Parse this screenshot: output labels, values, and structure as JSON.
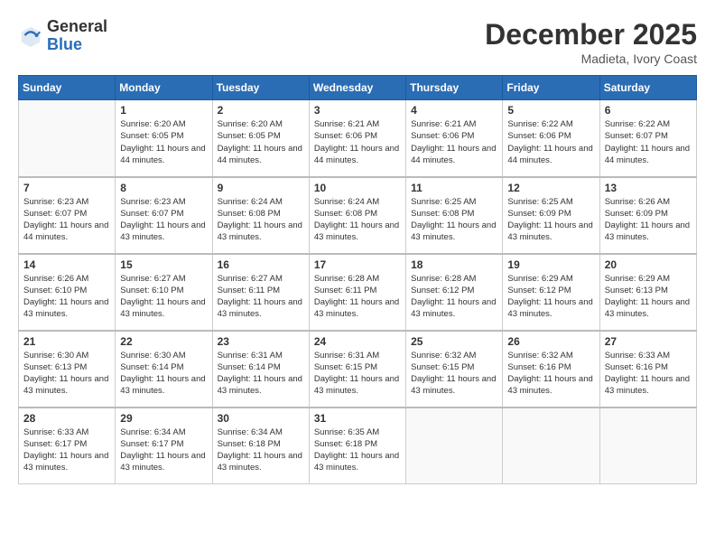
{
  "logo": {
    "general": "General",
    "blue": "Blue"
  },
  "title": "December 2025",
  "location": "Madieta, Ivory Coast",
  "days_of_week": [
    "Sunday",
    "Monday",
    "Tuesday",
    "Wednesday",
    "Thursday",
    "Friday",
    "Saturday"
  ],
  "weeks": [
    [
      {
        "day": "",
        "info": ""
      },
      {
        "day": "1",
        "info": "Sunrise: 6:20 AM\nSunset: 6:05 PM\nDaylight: 11 hours and 44 minutes."
      },
      {
        "day": "2",
        "info": "Sunrise: 6:20 AM\nSunset: 6:05 PM\nDaylight: 11 hours and 44 minutes."
      },
      {
        "day": "3",
        "info": "Sunrise: 6:21 AM\nSunset: 6:06 PM\nDaylight: 11 hours and 44 minutes."
      },
      {
        "day": "4",
        "info": "Sunrise: 6:21 AM\nSunset: 6:06 PM\nDaylight: 11 hours and 44 minutes."
      },
      {
        "day": "5",
        "info": "Sunrise: 6:22 AM\nSunset: 6:06 PM\nDaylight: 11 hours and 44 minutes."
      },
      {
        "day": "6",
        "info": "Sunrise: 6:22 AM\nSunset: 6:07 PM\nDaylight: 11 hours and 44 minutes."
      }
    ],
    [
      {
        "day": "7",
        "info": "Sunrise: 6:23 AM\nSunset: 6:07 PM\nDaylight: 11 hours and 44 minutes."
      },
      {
        "day": "8",
        "info": "Sunrise: 6:23 AM\nSunset: 6:07 PM\nDaylight: 11 hours and 43 minutes."
      },
      {
        "day": "9",
        "info": "Sunrise: 6:24 AM\nSunset: 6:08 PM\nDaylight: 11 hours and 43 minutes."
      },
      {
        "day": "10",
        "info": "Sunrise: 6:24 AM\nSunset: 6:08 PM\nDaylight: 11 hours and 43 minutes."
      },
      {
        "day": "11",
        "info": "Sunrise: 6:25 AM\nSunset: 6:08 PM\nDaylight: 11 hours and 43 minutes."
      },
      {
        "day": "12",
        "info": "Sunrise: 6:25 AM\nSunset: 6:09 PM\nDaylight: 11 hours and 43 minutes."
      },
      {
        "day": "13",
        "info": "Sunrise: 6:26 AM\nSunset: 6:09 PM\nDaylight: 11 hours and 43 minutes."
      }
    ],
    [
      {
        "day": "14",
        "info": "Sunrise: 6:26 AM\nSunset: 6:10 PM\nDaylight: 11 hours and 43 minutes."
      },
      {
        "day": "15",
        "info": "Sunrise: 6:27 AM\nSunset: 6:10 PM\nDaylight: 11 hours and 43 minutes."
      },
      {
        "day": "16",
        "info": "Sunrise: 6:27 AM\nSunset: 6:11 PM\nDaylight: 11 hours and 43 minutes."
      },
      {
        "day": "17",
        "info": "Sunrise: 6:28 AM\nSunset: 6:11 PM\nDaylight: 11 hours and 43 minutes."
      },
      {
        "day": "18",
        "info": "Sunrise: 6:28 AM\nSunset: 6:12 PM\nDaylight: 11 hours and 43 minutes."
      },
      {
        "day": "19",
        "info": "Sunrise: 6:29 AM\nSunset: 6:12 PM\nDaylight: 11 hours and 43 minutes."
      },
      {
        "day": "20",
        "info": "Sunrise: 6:29 AM\nSunset: 6:13 PM\nDaylight: 11 hours and 43 minutes."
      }
    ],
    [
      {
        "day": "21",
        "info": "Sunrise: 6:30 AM\nSunset: 6:13 PM\nDaylight: 11 hours and 43 minutes."
      },
      {
        "day": "22",
        "info": "Sunrise: 6:30 AM\nSunset: 6:14 PM\nDaylight: 11 hours and 43 minutes."
      },
      {
        "day": "23",
        "info": "Sunrise: 6:31 AM\nSunset: 6:14 PM\nDaylight: 11 hours and 43 minutes."
      },
      {
        "day": "24",
        "info": "Sunrise: 6:31 AM\nSunset: 6:15 PM\nDaylight: 11 hours and 43 minutes."
      },
      {
        "day": "25",
        "info": "Sunrise: 6:32 AM\nSunset: 6:15 PM\nDaylight: 11 hours and 43 minutes."
      },
      {
        "day": "26",
        "info": "Sunrise: 6:32 AM\nSunset: 6:16 PM\nDaylight: 11 hours and 43 minutes."
      },
      {
        "day": "27",
        "info": "Sunrise: 6:33 AM\nSunset: 6:16 PM\nDaylight: 11 hours and 43 minutes."
      }
    ],
    [
      {
        "day": "28",
        "info": "Sunrise: 6:33 AM\nSunset: 6:17 PM\nDaylight: 11 hours and 43 minutes."
      },
      {
        "day": "29",
        "info": "Sunrise: 6:34 AM\nSunset: 6:17 PM\nDaylight: 11 hours and 43 minutes."
      },
      {
        "day": "30",
        "info": "Sunrise: 6:34 AM\nSunset: 6:18 PM\nDaylight: 11 hours and 43 minutes."
      },
      {
        "day": "31",
        "info": "Sunrise: 6:35 AM\nSunset: 6:18 PM\nDaylight: 11 hours and 43 minutes."
      },
      {
        "day": "",
        "info": ""
      },
      {
        "day": "",
        "info": ""
      },
      {
        "day": "",
        "info": ""
      }
    ]
  ]
}
